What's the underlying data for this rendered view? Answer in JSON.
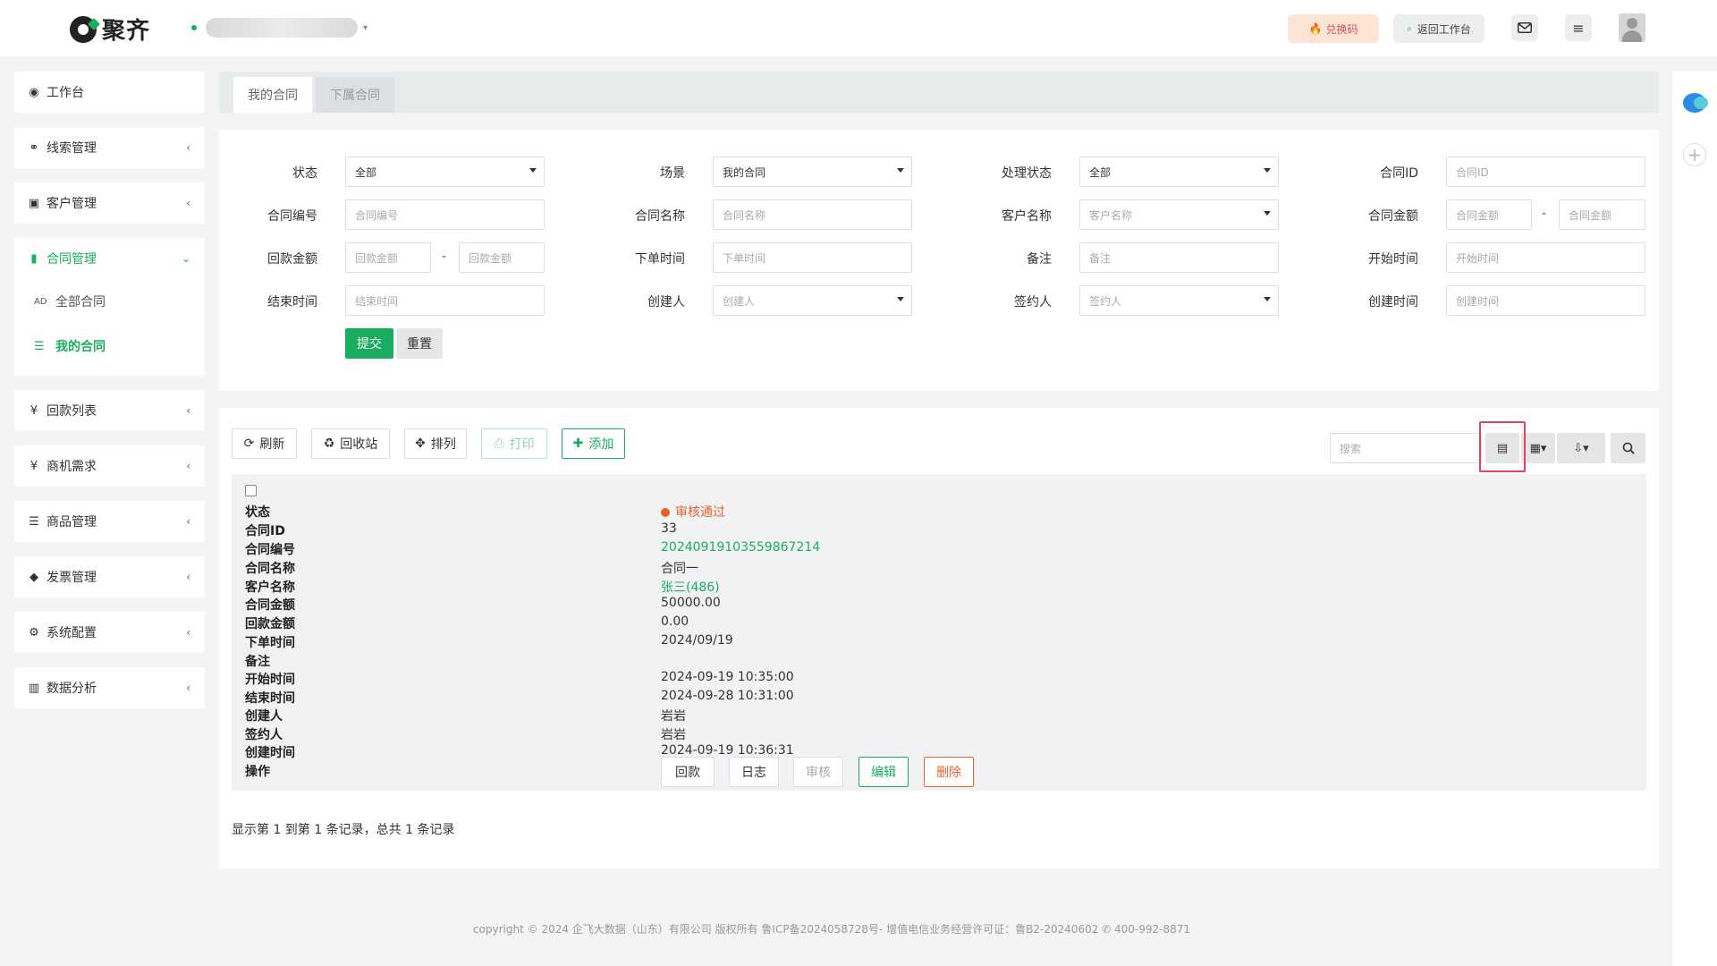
{
  "header": {
    "logo_text": "聚齐",
    "exchange_label": "兑换码",
    "back_label": "返回工作台"
  },
  "sidebar": {
    "items": [
      {
        "label": "工作台"
      },
      {
        "label": "线索管理"
      },
      {
        "label": "客户管理"
      },
      {
        "label": "合同管理"
      },
      {
        "label": "回款列表"
      },
      {
        "label": "商机需求"
      },
      {
        "label": "商品管理"
      },
      {
        "label": "发票管理"
      },
      {
        "label": "系统配置"
      },
      {
        "label": "数据分析"
      }
    ],
    "sub_items": [
      {
        "label": "全部合同"
      },
      {
        "label": "我的合同"
      }
    ]
  },
  "tabs": [
    {
      "label": "我的合同"
    },
    {
      "label": "下属合同"
    }
  ],
  "filters": {
    "status_label": "状态",
    "status_value": "全部",
    "scene_label": "场景",
    "scene_value": "我的合同",
    "process_label": "处理状态",
    "process_value": "全部",
    "contract_id_label": "合同ID",
    "contract_id_ph": "合同ID",
    "contract_no_label": "合同编号",
    "contract_no_ph": "合同编号",
    "contract_name_label": "合同名称",
    "contract_name_ph": "合同名称",
    "customer_label": "客户名称",
    "customer_ph": "客户名称",
    "amount_label": "合同金额",
    "amount_ph": "合同金额",
    "dash": "-",
    "return_amount_label": "回款金额",
    "return_amount_ph": "回款金额",
    "order_time_label": "下单时间",
    "order_time_ph": "下单时间",
    "remark_label": "备注",
    "remark_ph": "备注",
    "start_label": "开始时间",
    "start_ph": "开始时间",
    "end_label": "结束时间",
    "end_ph": "结束时间",
    "creator_label": "创建人",
    "creator_ph": "创建人",
    "signer_label": "签约人",
    "signer_ph": "签约人",
    "created_label": "创建时间",
    "created_ph": "创建时间",
    "submit_label": "提交",
    "reset_label": "重置"
  },
  "toolbar": {
    "refresh": "刷新",
    "recycle": "回收站",
    "sort": "排列",
    "print": "打印",
    "add": "添加",
    "search_ph": "搜索"
  },
  "record": {
    "fields": [
      {
        "key": "状态",
        "value": "审核通过"
      },
      {
        "key": "合同ID",
        "value": "33"
      },
      {
        "key": "合同编号",
        "value": "20240919103559867214"
      },
      {
        "key": "合同名称",
        "value": "合同一"
      },
      {
        "key": "客户名称",
        "value": "张三(486)"
      },
      {
        "key": "合同金额",
        "value": "50000.00"
      },
      {
        "key": "回款金额",
        "value": "0.00"
      },
      {
        "key": "下单时间",
        "value": "2024/09/19"
      },
      {
        "key": "备注",
        "value": ""
      },
      {
        "key": "开始时间",
        "value": "2024-09-19 10:35:00"
      },
      {
        "key": "结束时间",
        "value": "2024-09-28 10:31:00"
      },
      {
        "key": "创建人",
        "value": "岩岩"
      },
      {
        "key": "签约人",
        "value": "岩岩"
      },
      {
        "key": "创建时间",
        "value": "2024-09-19 10:36:31"
      },
      {
        "key": "操作",
        "value": ""
      }
    ],
    "actions": {
      "payback": "回款",
      "log": "日志",
      "audit": "审核",
      "edit": "编辑",
      "delete": "删除"
    }
  },
  "pagination": {
    "info": "显示第 1 到第 1 条记录，总共 1 条记录"
  },
  "footer": {
    "text": "copyright © 2024 企飞大数据（山东）有限公司 版权所有  鲁ICP备2024058728号-  增值电信业务经营许可证：鲁B2-20240602 ✆ 400-992-8871"
  },
  "colors": {
    "brand": "#1aad5e",
    "status_approved": "#e8612c",
    "highlight": "#e0435a"
  }
}
